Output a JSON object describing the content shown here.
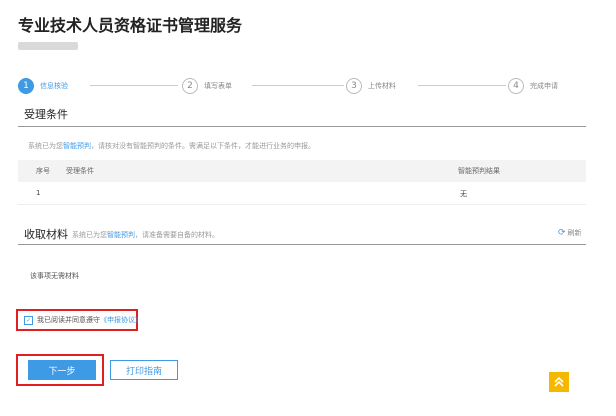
{
  "page_title": "专业技术人员资格证书管理服务",
  "steps": [
    {
      "number": "1",
      "label": "信息核验"
    },
    {
      "number": "2",
      "label": "填写表单"
    },
    {
      "number": "3",
      "label": "上传材料"
    },
    {
      "number": "4",
      "label": "完成申请"
    }
  ],
  "conditions": {
    "title": "受理条件",
    "note_prefix": "系统已为您",
    "note_link": "智能预判",
    "note_suffix": "，请核对没有智能预判的条件。需满足以下条件，才能进行业务的申报。",
    "table": {
      "headers": [
        "序号",
        "受理条件",
        "智能预判结果"
      ],
      "rows": [
        [
          "1",
          "",
          "无"
        ]
      ]
    }
  },
  "materials": {
    "title": "收取材料",
    "note_prefix": "系统已为您",
    "note_link": "智能预判",
    "note_suffix": "，请准备需要自备的材料。",
    "refresh_label": "刷新",
    "empty_text": "该事项无需材料"
  },
  "agreement": {
    "prefix": "我已阅读并同意遵守",
    "link": "《申报协议》",
    "checked": true
  },
  "buttons": {
    "next": "下一步",
    "print": "打印指南"
  },
  "colors": {
    "accent": "#3f9ae6",
    "highlight_border": "#e02020",
    "fab": "#f5b800"
  }
}
